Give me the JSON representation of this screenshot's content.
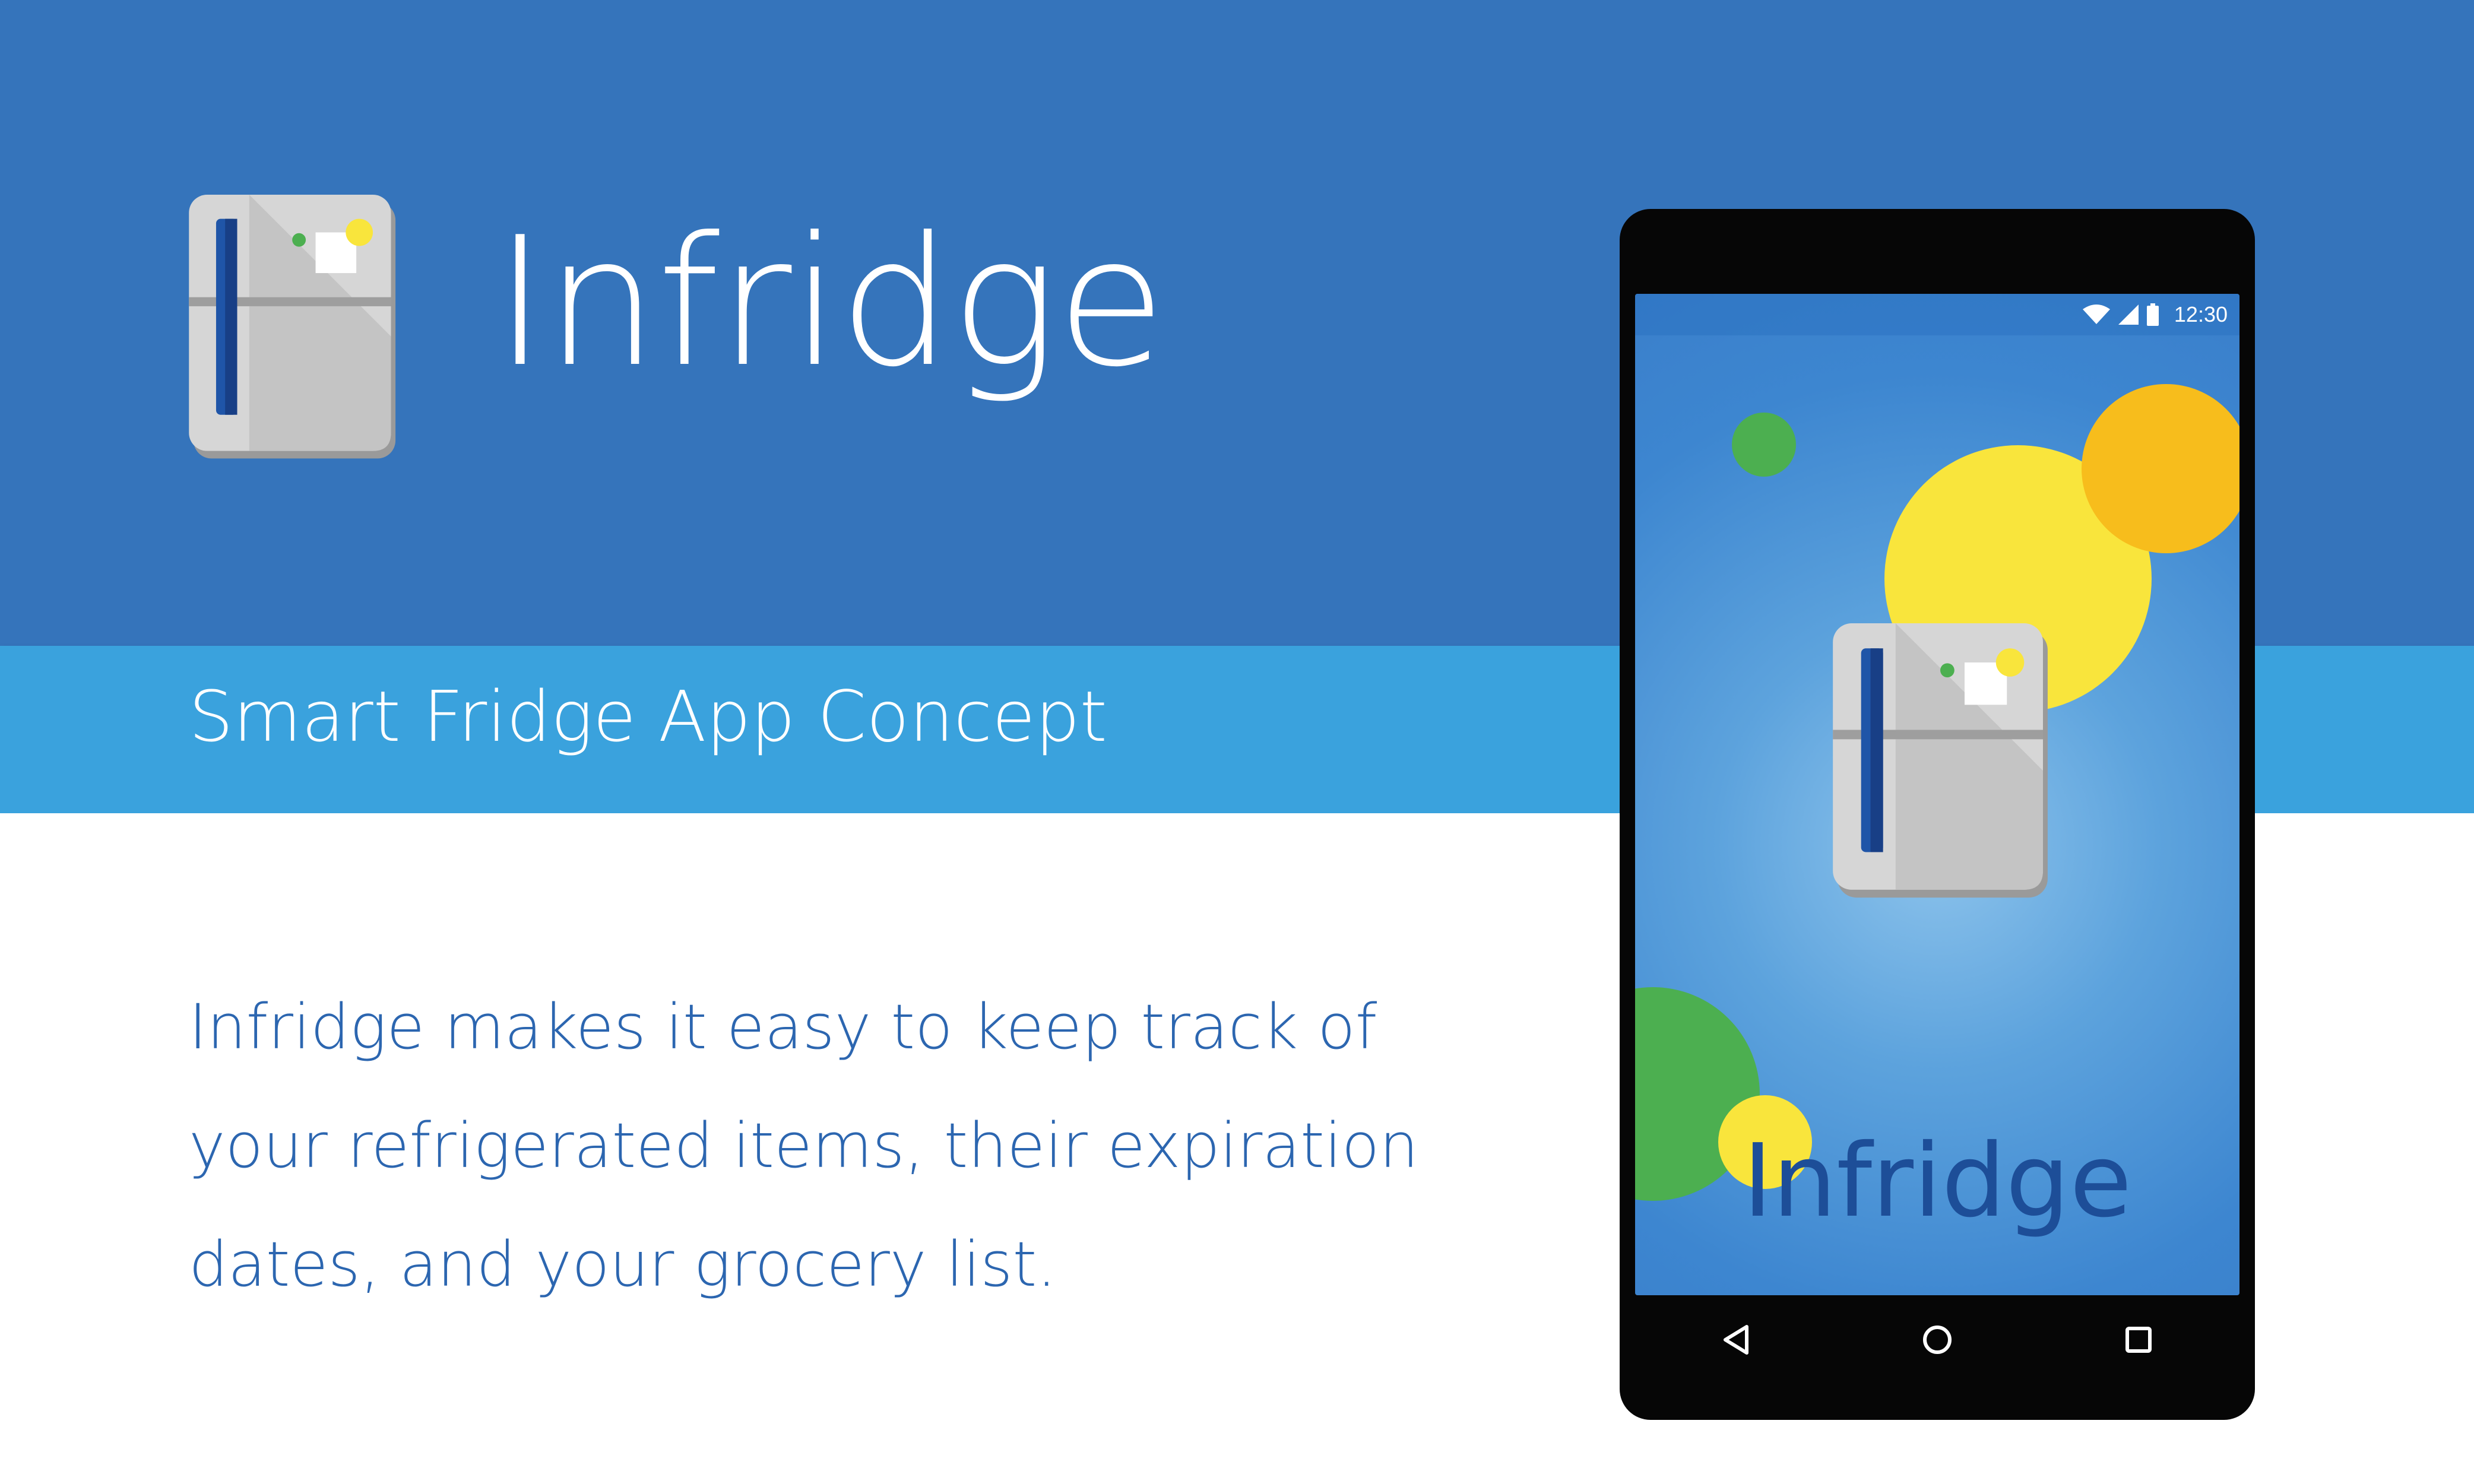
{
  "brand": {
    "app_name": "Infridge",
    "tagline": "Smart Fridge App Concept",
    "description": "Infridge makes it easy to keep track of your refrigerated items, their expiration dates, and your grocery list."
  },
  "phone": {
    "status_bar": {
      "time": "12:30",
      "icons": [
        "wifi-icon",
        "signal-icon",
        "battery-icon"
      ]
    },
    "splash_title": "Infridge",
    "nav_bar": [
      "back-icon",
      "home-icon",
      "recents-icon"
    ]
  },
  "colors": {
    "header_blue": "#3574bb",
    "band_blue": "#3aa2dd",
    "text_blue": "#2c66b0",
    "phone_title_blue": "#1d4e98",
    "yellow": "#f9e53c",
    "orange": "#f7bd1c",
    "green": "#4caf50"
  }
}
